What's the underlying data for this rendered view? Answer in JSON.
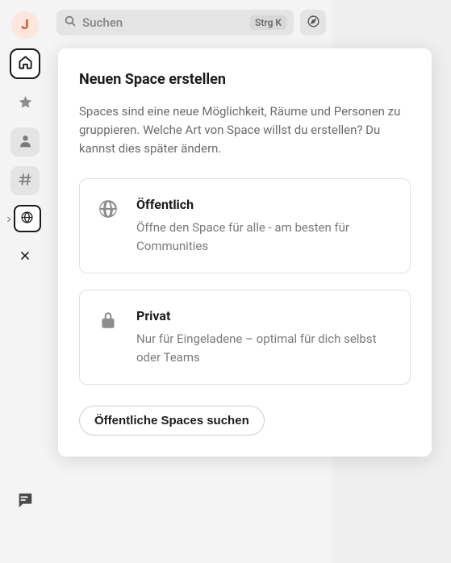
{
  "avatar_initial": "J",
  "search": {
    "placeholder": "Suchen",
    "shortcut": "Strg K"
  },
  "modal": {
    "title": "Neuen Space erstellen",
    "description": "Spaces sind eine neue Möglichkeit, Räume und Personen zu gruppieren. Welche Art von Space willst du erstellen? Du kannst dies später ändern.",
    "public": {
      "title": "Öffentlich",
      "desc": "Öffne den Space für alle - am besten für Communities"
    },
    "private": {
      "title": "Privat",
      "desc": "Nur für Eingeladene – optimal für dich selbst oder Teams"
    },
    "search_button": "Öffentliche Spaces suchen"
  }
}
